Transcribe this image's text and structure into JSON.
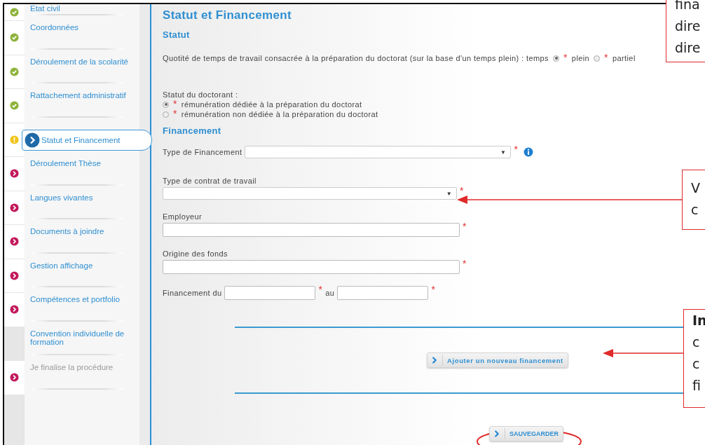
{
  "sidebar": {
    "items": [
      {
        "label": "Etat civil",
        "kind": "done",
        "selected": false,
        "disabled": false
      },
      {
        "label": "Coordonnées",
        "kind": "done",
        "selected": false,
        "disabled": false
      },
      {
        "label": "Déroulement de la scolarité",
        "kind": "done",
        "selected": false,
        "disabled": false
      },
      {
        "label": "Rattachement administratif",
        "kind": "done",
        "selected": false,
        "disabled": false
      },
      {
        "label": "Statut et Financement",
        "kind": "warning",
        "selected": true,
        "disabled": false
      },
      {
        "label": "Déroulement Thèse",
        "kind": "todo",
        "selected": false,
        "disabled": false
      },
      {
        "label": "Langues vivantes",
        "kind": "todo",
        "selected": false,
        "disabled": false
      },
      {
        "label": "Documents à joindre",
        "kind": "todo",
        "selected": false,
        "disabled": false
      },
      {
        "label": "Gestion affichage",
        "kind": "todo",
        "selected": false,
        "disabled": false
      },
      {
        "label": "Compétences et portfolio",
        "kind": "todo",
        "selected": false,
        "disabled": false
      },
      {
        "label": "Convention individuelle de formation",
        "kind": "none",
        "selected": false,
        "disabled": false
      },
      {
        "label": "Je finalise la procédure",
        "kind": "todo",
        "selected": false,
        "disabled": true
      }
    ]
  },
  "main": {
    "title": "Statut et Financement",
    "statut": {
      "heading": "Statut",
      "quotite": {
        "label": "Quotité de temps de travail consacrée à la préparation du doctorat (sur la base d'un temps plein) : temps",
        "options": [
          {
            "required": "*",
            "label": "plein",
            "selected": true
          },
          {
            "required": "*",
            "label": "partiel",
            "selected": false
          }
        ]
      },
      "doctorant": {
        "label": "Statut du doctorant :",
        "options": [
          {
            "required": "*",
            "label": "rémunération dédiée à la préparation du doctorat",
            "selected": true
          },
          {
            "required": "*",
            "label": "rémunération non dédiée à la préparation du doctorat",
            "selected": false
          }
        ]
      }
    },
    "financement": {
      "heading": "Financement",
      "type_financement": {
        "label": "Type de Financement",
        "caret": "▼",
        "required": "*"
      },
      "type_contrat": {
        "label": "Type de contrat de travail",
        "caret": "▼",
        "required": "*"
      },
      "employeur": {
        "label": "Employeur",
        "required": "*"
      },
      "origine": {
        "label": "Origine des fonds",
        "required": "*"
      },
      "periode": {
        "label_from": "Financement du",
        "required_from": "*",
        "label_to": "au",
        "required_to": "*"
      },
      "add_button": "Ajouter un nouveau financement"
    },
    "save_button": "SAUVEGARDER"
  },
  "callouts": [
    {
      "lines": [
        {
          "text": "fina",
          "bold": false
        },
        {
          "text": "dire",
          "bold": false
        },
        {
          "text": "dire",
          "bold": false
        }
      ]
    },
    {
      "lines": [
        {
          "text": "V",
          "bold": false
        },
        {
          "text": "c",
          "bold": false
        }
      ]
    },
    {
      "lines": [
        {
          "text": "In",
          "bold": true
        },
        {
          "text": "c",
          "bold": false
        },
        {
          "text": "c",
          "bold": false
        },
        {
          "text": "fi",
          "bold": false
        }
      ]
    }
  ]
}
